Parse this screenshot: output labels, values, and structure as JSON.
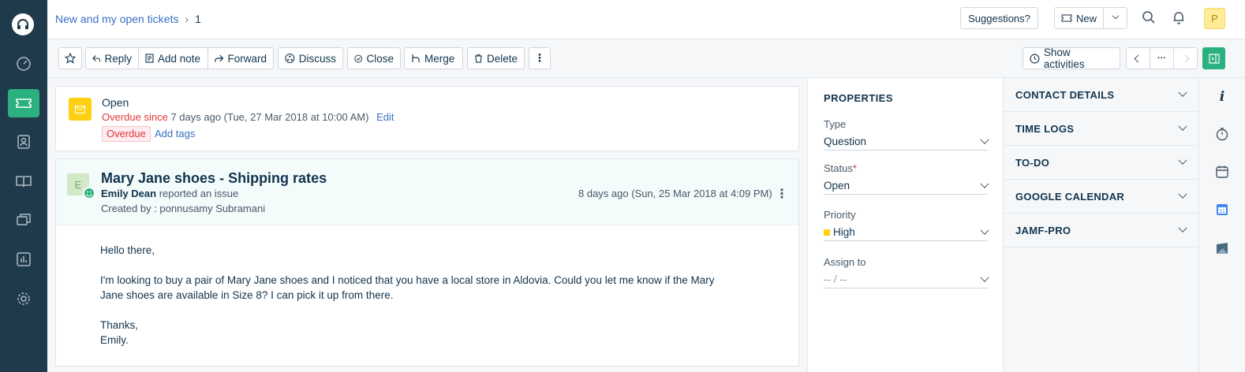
{
  "breadcrumb": {
    "link": "New and my open tickets",
    "count": "1"
  },
  "topbar": {
    "suggestions": "Suggestions?",
    "new_label": "New",
    "avatar_initial": "P"
  },
  "toolbar": {
    "reply": "Reply",
    "add_note": "Add note",
    "forward": "Forward",
    "discuss": "Discuss",
    "close": "Close",
    "merge": "Merge",
    "delete": "Delete",
    "show_activities": "Show activities",
    "more": "⋮"
  },
  "status_card": {
    "state": "Open",
    "overdue_prefix": "Overdue since",
    "overdue_time": "7 days ago (Tue, 27 Mar 2018 at 10:00 AM)",
    "edit": "Edit",
    "tag": "Overdue",
    "add_tags": "Add tags"
  },
  "ticket": {
    "avatar_initial": "E",
    "subject": "Mary Jane shoes - Shipping rates",
    "requester": "Emily Dean",
    "reported": "reported an issue",
    "created_by": "Created by : ponnusamy Subramani",
    "timestamp": "8 days ago (Sun, 25 Mar 2018 at 4:09 PM)"
  },
  "message": {
    "greeting": "Hello there,",
    "line1": "I'm looking to buy a pair of Mary Jane shoes and I noticed that you have a local store in Aldovia. Could you let me know if the Mary",
    "line2": "Jane shoes are available in Size 8? I can pick it up from there.",
    "thanks": "Thanks,",
    "signature": "Emily."
  },
  "properties": {
    "heading": "PROPERTIES",
    "type_label": "Type",
    "type_value": "Question",
    "status_label": "Status",
    "required_mark": "*",
    "status_value": "Open",
    "priority_label": "Priority",
    "priority_value": "High",
    "assign_label": "Assign to",
    "assign_value": "-- / --"
  },
  "sidebar_sections": [
    "CONTACT DETAILS",
    "TIME LOGS",
    "TO-DO",
    "GOOGLE CALENDAR",
    "JAMF-PRO"
  ],
  "colors": {
    "nav_bg": "#1f3a4b",
    "accent": "#2bb07f",
    "link": "#3a71c1",
    "overdue": "#e43538",
    "priority_high": "#ffd012",
    "status_icon_bg": "#ffd012"
  },
  "icons": [
    "headset-logo-icon",
    "dashboard-icon",
    "ticket-icon",
    "contacts-icon",
    "solutions-icon",
    "forums-icon",
    "reports-icon",
    "settings-icon",
    "search-icon",
    "bell-icon",
    "star-icon",
    "reply-icon",
    "note-icon",
    "forward-icon",
    "discuss-icon",
    "check-circle-icon",
    "merge-icon",
    "trash-icon",
    "clock-icon",
    "info-icon",
    "timer-icon",
    "calendar-icon",
    "google-calendar-icon",
    "jamf-icon"
  ]
}
